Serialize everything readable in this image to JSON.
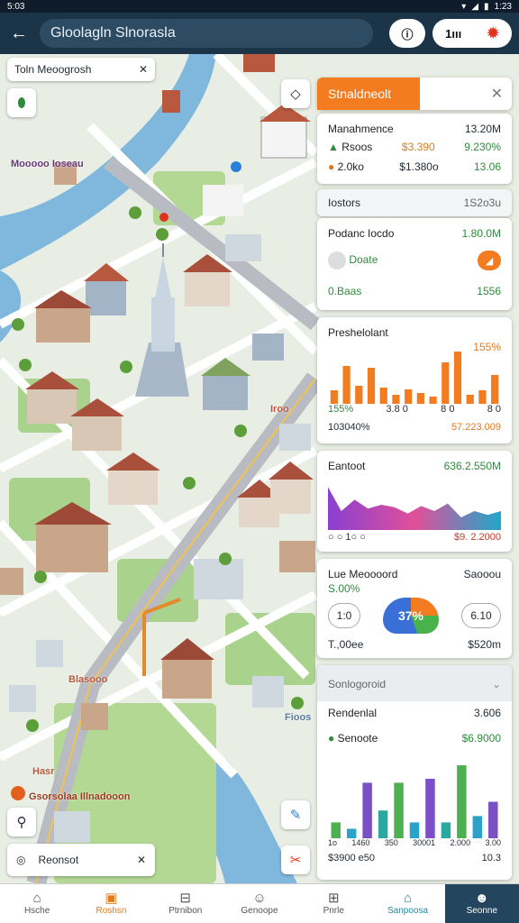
{
  "status_bar": {
    "time": "5:03",
    "clock": "1:23"
  },
  "header": {
    "search_text": "Gloolagln Slnorasla",
    "info_btn": "ⓘ",
    "menu_btn": "1ııı",
    "settings_icon": "gear-icon"
  },
  "map": {
    "top_chip_label": "Toln  Meoogrosh",
    "bottom_chip_label": "Reonsot",
    "labels": [
      "Mooooo Ioseau",
      "Iroo",
      "Blasooo",
      "Gsorsolaa Illnadooon",
      "Hasr",
      "Fioos"
    ]
  },
  "panel": {
    "alert": {
      "tab_label": "Stnaldneolt",
      "close": "✕"
    },
    "card1": {
      "title": "Manahmence",
      "title_value": "13.20M",
      "row1_label": "Rsoos",
      "row1_mid": "$3.390",
      "row1_val": "9.230%",
      "row2_label": "2.0ko",
      "row2_mid": "$1.380o",
      "row2_val": "13.06"
    },
    "section_header": {
      "label": "Iostors",
      "value": "1S2o3u"
    },
    "card2": {
      "title": "Podanc Iocdo",
      "value": "1.80.0M",
      "item": "Doate",
      "footer_label": "0.Baas",
      "footer_value": "1556"
    },
    "card3": {
      "title": "Preshelolant",
      "value": "155%",
      "legend1": "155%",
      "legend2": "3.8 0",
      "legend3": "8 0",
      "legend4": "8 0",
      "footer_left": "103040%",
      "footer_right": "57.223.009"
    },
    "card4": {
      "title": "Eantoot",
      "value": "636.2.550M",
      "footer_left": "○  ○ 1○  ○",
      "footer_right": "$9. 2.2000"
    },
    "card5": {
      "title": "Lue Meoooord",
      "value": "Saooou",
      "sub": "S.00%",
      "left_pill": "1:0",
      "gauge": "37%",
      "right_pill": "6.10",
      "footer_left": "T.,00ee",
      "footer_right": "$520m"
    },
    "card6": {
      "header": "Sonlogoroid",
      "title": "Rendenlal",
      "value": "3.606",
      "sub_label": "Senoote",
      "sub_value": "$6.9000",
      "x_labels": [
        "1o",
        "1460",
        "350",
        "30001",
        "2.000",
        "3.00"
      ],
      "footer_left": "$3900 e50",
      "footer_right": "10.3"
    }
  },
  "nav": {
    "items": [
      {
        "label": "Hsche",
        "icon": "home-icon"
      },
      {
        "label": "Roshsn",
        "icon": "pin-icon"
      },
      {
        "label": "Ptrnibon",
        "icon": "inbox-icon"
      },
      {
        "label": "Genoope",
        "icon": "user-icon"
      },
      {
        "label": "Pnrle",
        "icon": "basket-icon"
      },
      {
        "label": "Sanpoosa",
        "icon": "folder-icon"
      },
      {
        "label": "Seonne",
        "icon": "profile-icon"
      }
    ]
  },
  "chart_data": [
    {
      "type": "bar",
      "title": "Preshelolant",
      "values": [
        15,
        42,
        20,
        40,
        18,
        10,
        16,
        12,
        8,
        46,
        58,
        10,
        15,
        32
      ]
    },
    {
      "type": "area",
      "title": "Eantoot",
      "values": [
        68,
        30,
        48,
        34,
        40,
        36,
        26,
        38,
        30,
        42,
        20,
        30,
        24,
        30
      ]
    },
    {
      "type": "bar",
      "title": "Rendenlal",
      "values": [
        20,
        12,
        70,
        35,
        70,
        20,
        75,
        20,
        92,
        28,
        46
      ]
    }
  ],
  "colors": {
    "accent": "#f47c20",
    "header": "#1b3448",
    "green": "#2e8b3c"
  }
}
